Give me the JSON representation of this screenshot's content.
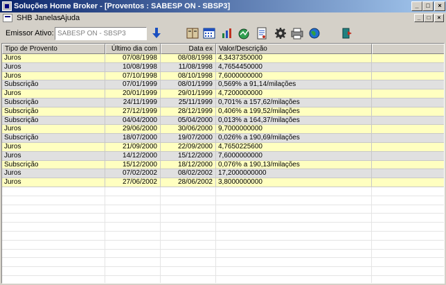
{
  "window": {
    "title": "Soluções Home Broker - [Proventos : SABESP ON - SBSP3]",
    "buttons": [
      "_",
      "□",
      "×"
    ]
  },
  "menu": {
    "items": [
      "SHB",
      "Janelas",
      "Ajuda"
    ],
    "mdi_buttons": [
      "_",
      "□",
      "×"
    ]
  },
  "toolbar": {
    "issuer_label": "Emissor Ativo:",
    "issuer_value": "SABESP ON - SBSP3",
    "icons": [
      "down-arrow-icon",
      "book-icon",
      "calendar-icon",
      "chart-icon",
      "globe-chart-icon",
      "document-icon",
      "gear-icon",
      "printer-icon",
      "globe-icon",
      "exit-door-icon"
    ]
  },
  "table": {
    "headers": [
      "Tipo de Provento",
      "Último dia com",
      "Data ex",
      "Valor/Descrição"
    ],
    "rows": [
      {
        "tipo": "Juros",
        "ultimo": "07/08/1998",
        "dataex": "08/08/1998",
        "valor": "4,3437350000",
        "color": "yellow"
      },
      {
        "tipo": "Juros",
        "ultimo": "10/08/1998",
        "dataex": "11/08/1998",
        "valor": "4,7654450000",
        "color": "gray"
      },
      {
        "tipo": "Juros",
        "ultimo": "07/10/1998",
        "dataex": "08/10/1998",
        "valor": "7,6000000000",
        "color": "yellow"
      },
      {
        "tipo": "Subscrição",
        "ultimo": "07/01/1999",
        "dataex": "08/01/1999",
        "valor": "0,569% a 91,14/milações",
        "color": "gray"
      },
      {
        "tipo": "Juros",
        "ultimo": "20/01/1999",
        "dataex": "29/01/1999",
        "valor": "4,7200000000",
        "color": "yellow"
      },
      {
        "tipo": "Subscrição",
        "ultimo": "24/11/1999",
        "dataex": "25/11/1999",
        "valor": "0,701% a 157,62/milações",
        "color": "gray"
      },
      {
        "tipo": "Subscrição",
        "ultimo": "27/12/1999",
        "dataex": "28/12/1999",
        "valor": "0,406% a 199,52/milações",
        "color": "yellow"
      },
      {
        "tipo": "Subscrição",
        "ultimo": "04/04/2000",
        "dataex": "05/04/2000",
        "valor": "0,013% a 164,37/milações",
        "color": "gray"
      },
      {
        "tipo": "Juros",
        "ultimo": "29/06/2000",
        "dataex": "30/06/2000",
        "valor": "9,7000000000",
        "color": "yellow"
      },
      {
        "tipo": "Subscrição",
        "ultimo": "18/07/2000",
        "dataex": "19/07/2000",
        "valor": "0,026% a 190,69/milações",
        "color": "gray"
      },
      {
        "tipo": "Juros",
        "ultimo": "21/09/2000",
        "dataex": "22/09/2000",
        "valor": "4,7650225600",
        "color": "yellow"
      },
      {
        "tipo": "Juros",
        "ultimo": "14/12/2000",
        "dataex": "15/12/2000",
        "valor": "7,6000000000",
        "color": "gray"
      },
      {
        "tipo": "Subscrição",
        "ultimo": "15/12/2000",
        "dataex": "18/12/2000",
        "valor": "0,076% a 190,13/milações",
        "color": "yellow"
      },
      {
        "tipo": "Juros",
        "ultimo": "07/02/2002",
        "dataex": "08/02/2002",
        "valor": "17,2000000000",
        "color": "gray"
      },
      {
        "tipo": "Juros",
        "ultimo": "27/06/2002",
        "dataex": "28/06/2002",
        "valor": "3,8000000000",
        "color": "yellow"
      }
    ]
  }
}
